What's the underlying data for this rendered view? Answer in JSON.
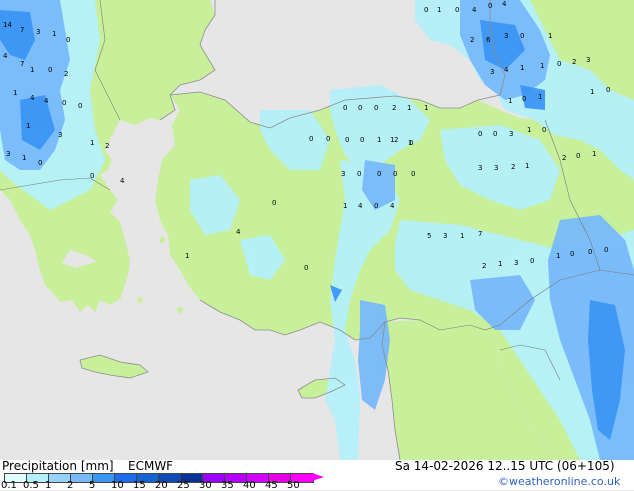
{
  "footer": {
    "title": "Precipitation [mm]",
    "model": "ECMWF",
    "datetime": "Sa 14-02-2026 12..15 UTC (06+105)",
    "credit": "©weatheronline.co.uk"
  },
  "colorbar": {
    "ticks": [
      "0.1",
      "0.5",
      "1",
      "2",
      "5",
      "10",
      "15",
      "20",
      "25",
      "30",
      "35",
      "40",
      "45",
      "50"
    ],
    "colors": [
      "#e0ffff",
      "#b4f0fa",
      "#96d2fa",
      "#78b9fa",
      "#3c96f5",
      "#1e6eeb",
      "#1464d2",
      "#0f4bb4",
      "#0a3296",
      "#9b00ff",
      "#b400ff",
      "#d200ff",
      "#e600e6",
      "#ff00ff"
    ]
  },
  "map": {
    "land_color": "#c8f09b",
    "sea_color": "#e6e6e6",
    "precip_light": "#b4f0fa",
    "precip_mid": "#96d2fa",
    "precip_heavy": "#3c96f5",
    "labels": [
      {
        "t": "14"
      },
      {
        "t": "7"
      },
      {
        "t": "3"
      },
      {
        "t": "1"
      },
      {
        "t": "0"
      },
      {
        "t": "4"
      },
      {
        "t": "7"
      },
      {
        "t": "1"
      },
      {
        "t": "0"
      },
      {
        "t": "2"
      },
      {
        "t": "1"
      },
      {
        "t": "4"
      },
      {
        "t": "4"
      },
      {
        "t": "0"
      },
      {
        "t": "0"
      },
      {
        "t": "1"
      },
      {
        "t": "3"
      },
      {
        "t": "1"
      },
      {
        "t": "2"
      },
      {
        "t": "3"
      },
      {
        "t": "1"
      },
      {
        "t": "0"
      },
      {
        "t": "0"
      },
      {
        "t": "4"
      },
      {
        "t": "0"
      },
      {
        "t": "1"
      },
      {
        "t": "0"
      },
      {
        "t": "4"
      },
      {
        "t": "0"
      },
      {
        "t": "4"
      },
      {
        "t": "2"
      },
      {
        "t": "6"
      },
      {
        "t": "3"
      },
      {
        "t": "0"
      },
      {
        "t": "1"
      },
      {
        "t": "3"
      },
      {
        "t": "4"
      },
      {
        "t": "1"
      },
      {
        "t": "1"
      },
      {
        "t": "0"
      },
      {
        "t": "2"
      },
      {
        "t": "3"
      },
      {
        "t": "1"
      },
      {
        "t": "0"
      },
      {
        "t": "1"
      },
      {
        "t": "1"
      },
      {
        "t": "0"
      },
      {
        "t": "0"
      },
      {
        "t": "0"
      },
      {
        "t": "0"
      },
      {
        "t": "2"
      },
      {
        "t": "1"
      },
      {
        "t": "1"
      },
      {
        "t": "1"
      },
      {
        "t": "1"
      },
      {
        "t": "0"
      },
      {
        "t": "0"
      },
      {
        "t": "3"
      },
      {
        "t": "1"
      },
      {
        "t": "0"
      },
      {
        "t": "0"
      },
      {
        "t": "0"
      },
      {
        "t": "0"
      },
      {
        "t": "0"
      },
      {
        "t": "1"
      },
      {
        "t": "2"
      },
      {
        "t": "0"
      },
      {
        "t": "3"
      },
      {
        "t": "3"
      },
      {
        "t": "2"
      },
      {
        "t": "1"
      },
      {
        "t": "2"
      },
      {
        "t": "0"
      },
      {
        "t": "1"
      },
      {
        "t": "3"
      },
      {
        "t": "0"
      },
      {
        "t": "0"
      },
      {
        "t": "0"
      },
      {
        "t": "0"
      },
      {
        "t": "0"
      },
      {
        "t": "1"
      },
      {
        "t": "4"
      },
      {
        "t": "0"
      },
      {
        "t": "4"
      },
      {
        "t": "4"
      },
      {
        "t": "5"
      },
      {
        "t": "3"
      },
      {
        "t": "1"
      },
      {
        "t": "7"
      },
      {
        "t": "2"
      },
      {
        "t": "1"
      },
      {
        "t": "3"
      },
      {
        "t": "0"
      },
      {
        "t": "1"
      },
      {
        "t": "0"
      },
      {
        "t": "0"
      },
      {
        "t": "0"
      },
      {
        "t": "1"
      },
      {
        "t": "0"
      }
    ]
  }
}
